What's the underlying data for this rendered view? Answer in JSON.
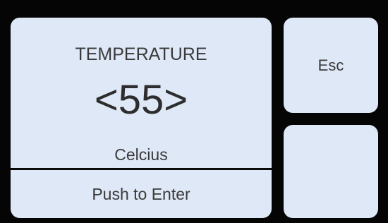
{
  "screen": {
    "title": "TEMPERATURE",
    "value_display": "<55>",
    "value": 55,
    "unit": "Celcius",
    "enter_label": "Push to Enter"
  },
  "side_buttons": {
    "esc_label": "Esc",
    "blank_label": ""
  },
  "colors": {
    "background": "#000000",
    "panel": "#dfe8f6",
    "text": "#3a3a3a"
  }
}
